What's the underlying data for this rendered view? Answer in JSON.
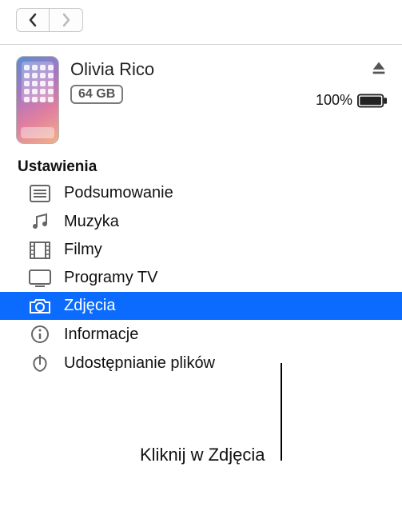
{
  "nav": {
    "back_enabled": true,
    "forward_enabled": false
  },
  "device": {
    "name": "Olivia Rico",
    "storage": "64 GB",
    "battery_percent": "100%"
  },
  "sidebar": {
    "section_title": "Ustawienia",
    "items": [
      {
        "label": "Podsumowanie",
        "icon": "list-icon",
        "selected": false
      },
      {
        "label": "Muzyka",
        "icon": "music-icon",
        "selected": false
      },
      {
        "label": "Filmy",
        "icon": "film-icon",
        "selected": false
      },
      {
        "label": "Programy TV",
        "icon": "tv-icon",
        "selected": false
      },
      {
        "label": "Zdjęcia",
        "icon": "camera-icon",
        "selected": true
      },
      {
        "label": "Informacje",
        "icon": "info-icon",
        "selected": false
      },
      {
        "label": "Udostępnianie plików",
        "icon": "apps-icon",
        "selected": false
      }
    ]
  },
  "callout": {
    "text": "Kliknij w Zdjęcia"
  }
}
